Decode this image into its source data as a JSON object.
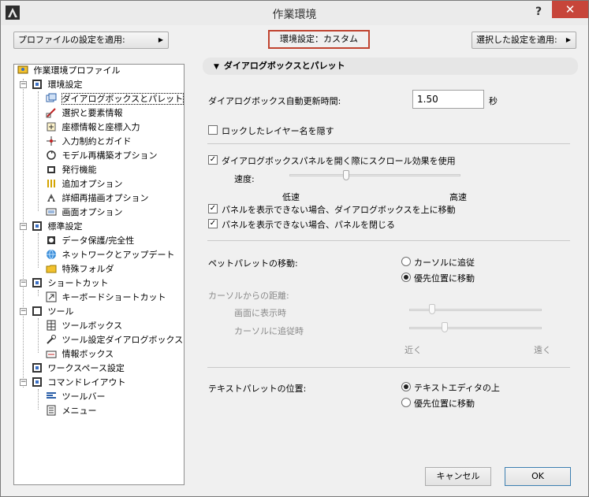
{
  "window": {
    "title": "作業環境",
    "help": "?",
    "close": "✕"
  },
  "toolbar": {
    "apply_profile": "プロファイルの設定を適用:",
    "env_setting": "環境設定：カスタム",
    "apply_selected": "選択した設定を適用:"
  },
  "tree": {
    "root": "作業環境プロファイル",
    "env": "環境設定",
    "env_items": [
      "ダイアログボックスとパレット",
      "選択と要素情報",
      "座標情報と座標入力",
      "入力制約とガイド",
      "モデル再構築オプション",
      "発行機能",
      "追加オプション",
      "詳細再描画オプション",
      "画面オプション"
    ],
    "std": "標準設定",
    "std_items": [
      "データ保護/完全性",
      "ネットワークとアップデート",
      "特殊フォルダ"
    ],
    "shortcut": "ショートカット",
    "shortcut_items": [
      "キーボードショートカット"
    ],
    "tools": "ツール",
    "tools_items": [
      "ツールボックス",
      "ツール設定ダイアログボックス",
      "情報ボックス"
    ],
    "workspace": "ワークスペース設定",
    "cmdlayout": "コマンドレイアウト",
    "cmd_items": [
      "ツールバー",
      "メニュー"
    ]
  },
  "panel": {
    "section": "ダイアログボックスとパレット",
    "autoupdate_label": "ダイアログボックス自動更新時間:",
    "autoupdate_value": "1.50",
    "autoupdate_unit": "秒",
    "lock_layer": "ロックしたレイヤー名を隠す",
    "scroll_effect": "ダイアログボックスパネルを開く際にスクロール効果を使用",
    "speed_label": "速度:",
    "speed_low": "低速",
    "speed_high": "高速",
    "speed_value": 0.33,
    "move_up": "パネルを表示できない場合、ダイアログボックスを上に移動",
    "close_panel": "パネルを表示できない場合、パネルを閉じる",
    "pet_move_label": "ペットパレットの移動:",
    "pet_opt1": "カーソルに追従",
    "pet_opt2": "優先位置に移動",
    "distance_label": "カーソルからの距離:",
    "dist_show": "画面に表示時",
    "dist_follow": "カーソルに追従時",
    "near": "近く",
    "far": "遠く",
    "dist_show_value": 0.17,
    "dist_follow_value": 0.27,
    "text_palette_label": "テキストパレットの位置:",
    "text_opt1": "テキストエディタの上",
    "text_opt2": "優先位置に移動"
  },
  "buttons": {
    "cancel": "キャンセル",
    "ok": "OK"
  }
}
